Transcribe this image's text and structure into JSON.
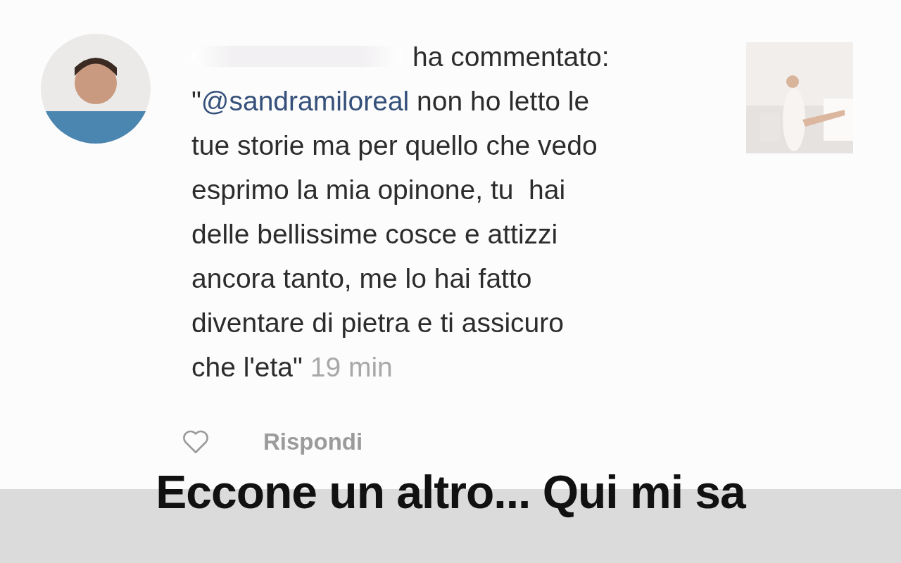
{
  "notification": {
    "header": "ha commentato:",
    "quote_open": "\"",
    "mention": "@sandramiloreal",
    "lines": [
      " non ho letto le",
      "tue storie ma per quello che vedo",
      "esprimo la mia opinone, tu  hai",
      "delle bellissime cosce e attizzi",
      "ancora tanto, me lo hai fatto",
      "diventare di pietra e ti assicuro",
      "che l'eta\""
    ],
    "time": "19 min",
    "liked": false,
    "reply": "Rispondi"
  },
  "caption": "Eccone un altro... Qui mi sa"
}
